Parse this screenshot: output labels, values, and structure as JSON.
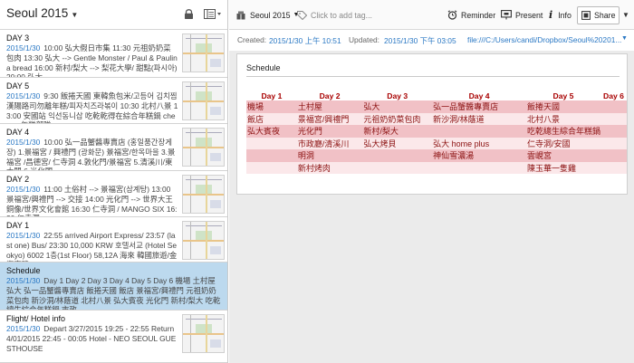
{
  "notebook": {
    "title": "Seoul 2015"
  },
  "notes": [
    {
      "title": "DAY 3",
      "date": "2015/1/30",
      "snippet": "10:00 弘大假日市集 11:30 元祖奶奶菜包肉 13:30 弘大 --> Gentle Monster / Paul & Paulina bread 16:00 新村/梨大 --> 梨花大學/ 甜點(파시아) 20:00 弘大",
      "has_thumb": true
    },
    {
      "title": "DAY 5",
      "date": "2015/1/30",
      "snippet": "9:30 飯捲天國 東韓魚包米/고등어 김치찜 漢陽路司勿離年糕/피자치즈라볶이 10:30 北村八景 13:00 安國站 익선동니삽 吃乾乾得在綜合年糕鍋 cheese 年糕部隊",
      "has_thumb": true
    },
    {
      "title": "DAY 4",
      "date": "2015/1/30",
      "snippet": "10:00 弘一品蟹醬專賣店 (홍일품간장게장) 1.景福宮 / 興禮門 (광화문) 景福宮/한옥마을 3.景福宮 /昌德宮/ 仁寺洞 4.敦化門/景福宮 5.清溪川/東大門 6.光化門",
      "has_thumb": true
    },
    {
      "title": "DAY 2",
      "date": "2015/1/30",
      "snippet": "11:00 土俗村 --> 景福宮(삼계탕) 13:00 景福宮/興禮門 --> 交接 14:00 光化門 --> 世界大王銅像/世界文化會館 16:30 仁寺洞 / MANGO SIX 16:30 仁寺洞",
      "has_thumb": true
    },
    {
      "title": "DAY 1",
      "date": "2015/1/30",
      "snippet": "22:55 arrived Airport Express/ 23:57 (last one) Bus/ 23:30 10,000 KRW 호텔서교 (Hotel Seokyo) 6002 1층(1st Floor) 58,12A 海來 韓國旅遊/金海南路",
      "has_thumb": true
    },
    {
      "title": "Schedule",
      "date": "2015/1/30",
      "snippet": "Day 1 Day 2 Day 3 Day 4 Day 5 Day 6 機場 土村屋 弘大 弘一品蟹醬專賣店 飯捲天國 飯店 景福宮/興禮門 元祖奶奶菜包肉 新沙洞/林蔭道 北村八景 弘大賓夜 光化門 新村/梨大 吃乾總生綜合年糕鍋 市政",
      "has_thumb": false
    },
    {
      "title": "Flight/ Hotel info",
      "date": "2015/1/30",
      "snippet": "Depart 3/27/2015 19:25 - 22:55 Return 4/01/2015 22:45 - 00:05 Hotel - NEO SEOUL GUESTHOUSE",
      "has_thumb": true
    }
  ],
  "toolbar": {
    "notebook": "Seoul 2015",
    "tag_placeholder": "Click to add tag...",
    "reminder": "Reminder",
    "present": "Present",
    "info": "Info",
    "share": "Share"
  },
  "meta": {
    "created_label": "Created:",
    "created": "2015/1/30 上午 10:51",
    "updated_label": "Updated:",
    "updated": "2015/1/30 下午 03:05",
    "link": "file:///C:/Users/candi/Dropbox/Seoul%20201..."
  },
  "note": {
    "title": "Schedule",
    "columns": [
      "Day 1",
      "Day 2",
      "Day 3",
      "Day 4",
      "Day 5",
      "Day 6"
    ],
    "rows": [
      [
        "機場",
        "土村屋",
        "弘大",
        "弘一品蟹醬專賣店",
        "飯捲天國",
        ""
      ],
      [
        "飯店",
        "景福宮/興禮門",
        "元祖奶奶菜包肉",
        "新沙洞/林蔭道",
        "北村八景",
        ""
      ],
      [
        "弘大賓夜",
        "光化門",
        "新村/梨大",
        "",
        "吃乾總生綜合年糕鍋",
        ""
      ],
      [
        "",
        "市政廳/清溪川",
        "弘大烤貝",
        "弘大 home plus",
        "仁寺洞/安國",
        ""
      ],
      [
        "",
        "明洞",
        "",
        "神仙雪濃湯",
        "雲峴宮",
        ""
      ],
      [
        "",
        "新村烤肉",
        "",
        "",
        "陳玉華一隻雞",
        ""
      ]
    ]
  }
}
